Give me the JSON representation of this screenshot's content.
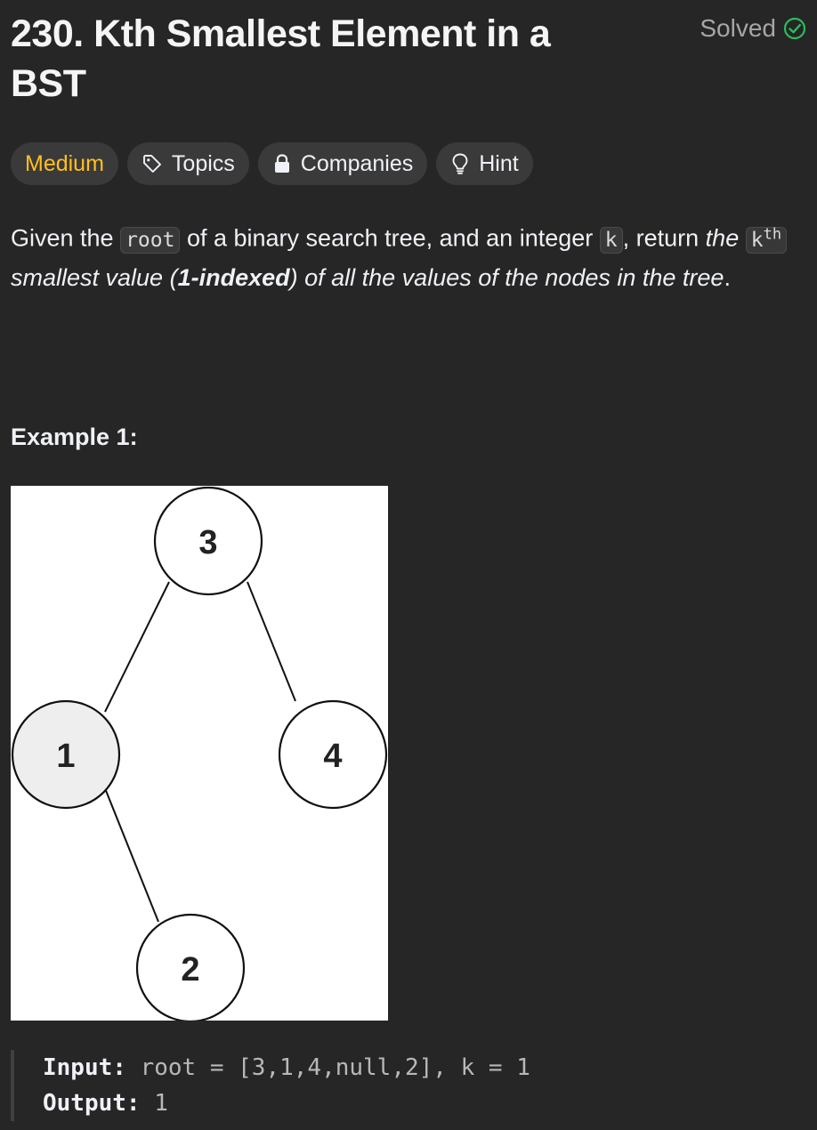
{
  "problem": {
    "title": "230. Kth Smallest Element in a BST",
    "status": "Solved",
    "status_color": "#2cbb5d"
  },
  "tags": {
    "difficulty": "Medium",
    "difficulty_color": "#ffc01e",
    "topics": "Topics",
    "companies": "Companies",
    "hint": "Hint"
  },
  "description": {
    "p1": "Given the ",
    "code_root": "root",
    "p2": " of a binary search tree, and an integer ",
    "code_k": "k",
    "p3": ", return ",
    "em1": "the",
    "code_kth_base": "k",
    "code_kth_sup": "th",
    "em2": " smallest value (",
    "strong": "1-indexed",
    "em3": ") of all the values of the nodes in the tree",
    "end": "."
  },
  "example": {
    "title": "Example 1:",
    "tree_nodes": [
      "3",
      "1",
      "4",
      "2"
    ],
    "input_label": "Input:",
    "input_value": " root = [3,1,4,null,2], k = 1",
    "output_label": "Output:",
    "output_value": " 1"
  },
  "icons": {
    "topics": "tag-icon",
    "companies": "lock-icon",
    "hint": "lightbulb-icon",
    "solved": "check-circle-icon"
  }
}
